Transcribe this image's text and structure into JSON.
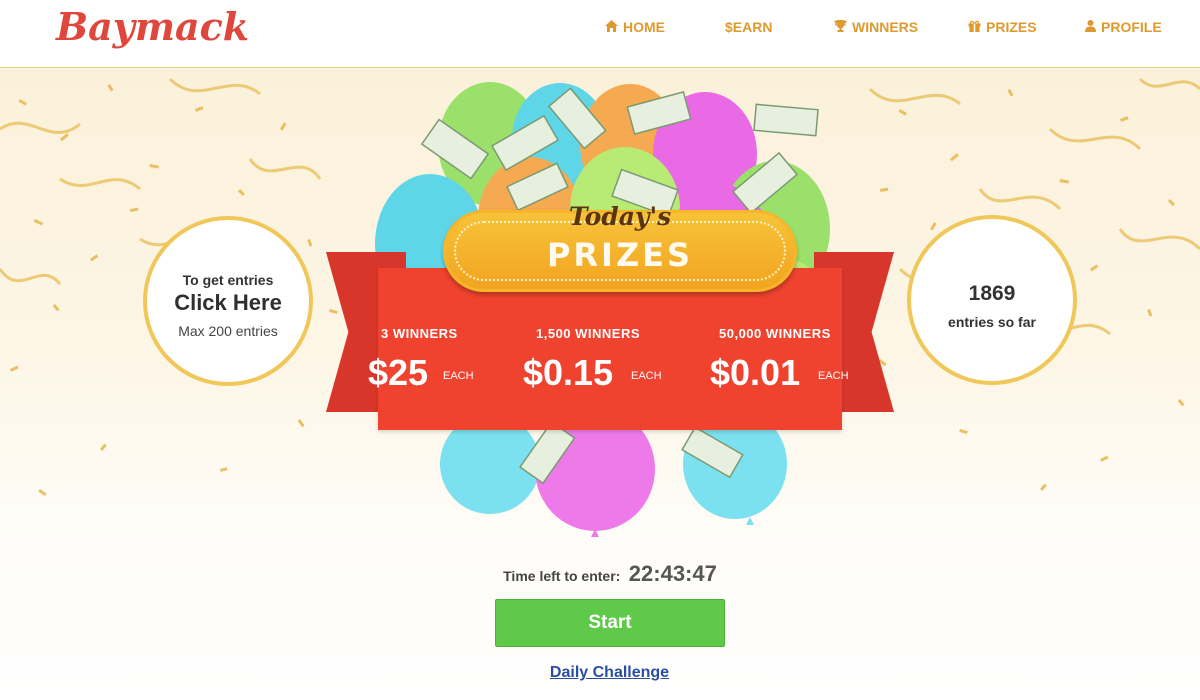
{
  "header": {
    "logo": "Baymack",
    "nav": [
      {
        "label": "HOME",
        "icon": "home-icon",
        "glyph": "⌂"
      },
      {
        "label": "$EARN",
        "icon": "",
        "glyph": ""
      },
      {
        "label": "WINNERS",
        "icon": "trophy-icon",
        "glyph": "🏆"
      },
      {
        "label": "PRIZES",
        "icon": "gift-icon",
        "glyph": "🎁"
      },
      {
        "label": "PROFILE",
        "icon": "user-icon",
        "glyph": "👤"
      }
    ]
  },
  "banner": {
    "todays": "Today's",
    "prizes": "PRIZES",
    "tiers": [
      {
        "winners": "3 WINNERS",
        "amount": "$25",
        "each": "EACH"
      },
      {
        "winners": "1,500 WINNERS",
        "amount": "$0.15",
        "each": "EACH"
      },
      {
        "winners": "50,000 WINNERS",
        "amount": "$0.01",
        "each": "EACH"
      }
    ]
  },
  "entries_cta": {
    "line1": "To get entries",
    "line2": "Click Here",
    "line3": "Max 200 entries"
  },
  "entries_count": {
    "count": "1869",
    "label": "entries so far"
  },
  "timer": {
    "label": "Time left to enter:",
    "value": "22:43:47"
  },
  "start_label": "Start",
  "daily_challenge": "Daily Challenge",
  "colors": {
    "brand_red": "#e0473c",
    "nav_gold": "#dd9a2e",
    "ribbon_red": "#f0432f",
    "start_green": "#5fc94a",
    "link_blue": "#2b4fa0"
  }
}
